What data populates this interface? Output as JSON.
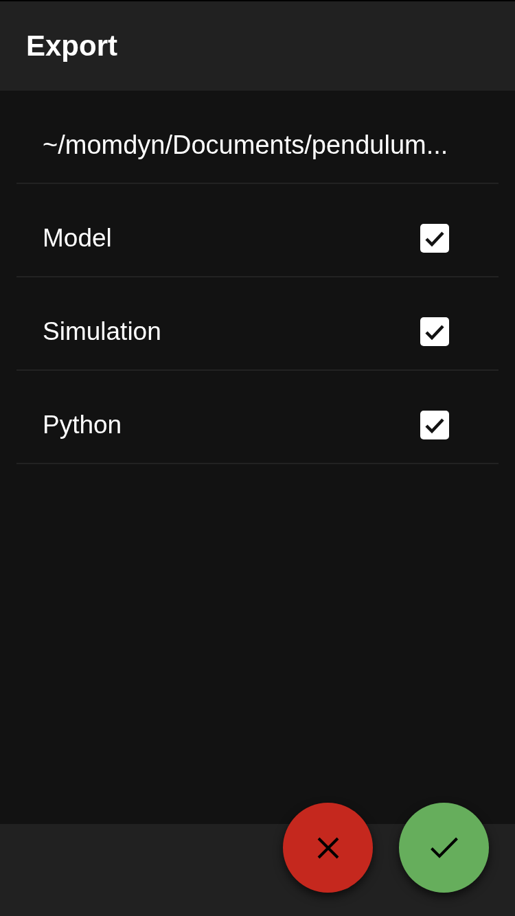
{
  "app_bar": {
    "title": "Export"
  },
  "file_path": "~/momdyn/Documents/pendulum...",
  "options": [
    {
      "label": "Model",
      "checked": true
    },
    {
      "label": "Simulation",
      "checked": true
    },
    {
      "label": "Python",
      "checked": true
    }
  ],
  "actions": [
    {
      "kind": "cancel"
    },
    {
      "kind": "confirm"
    }
  ]
}
